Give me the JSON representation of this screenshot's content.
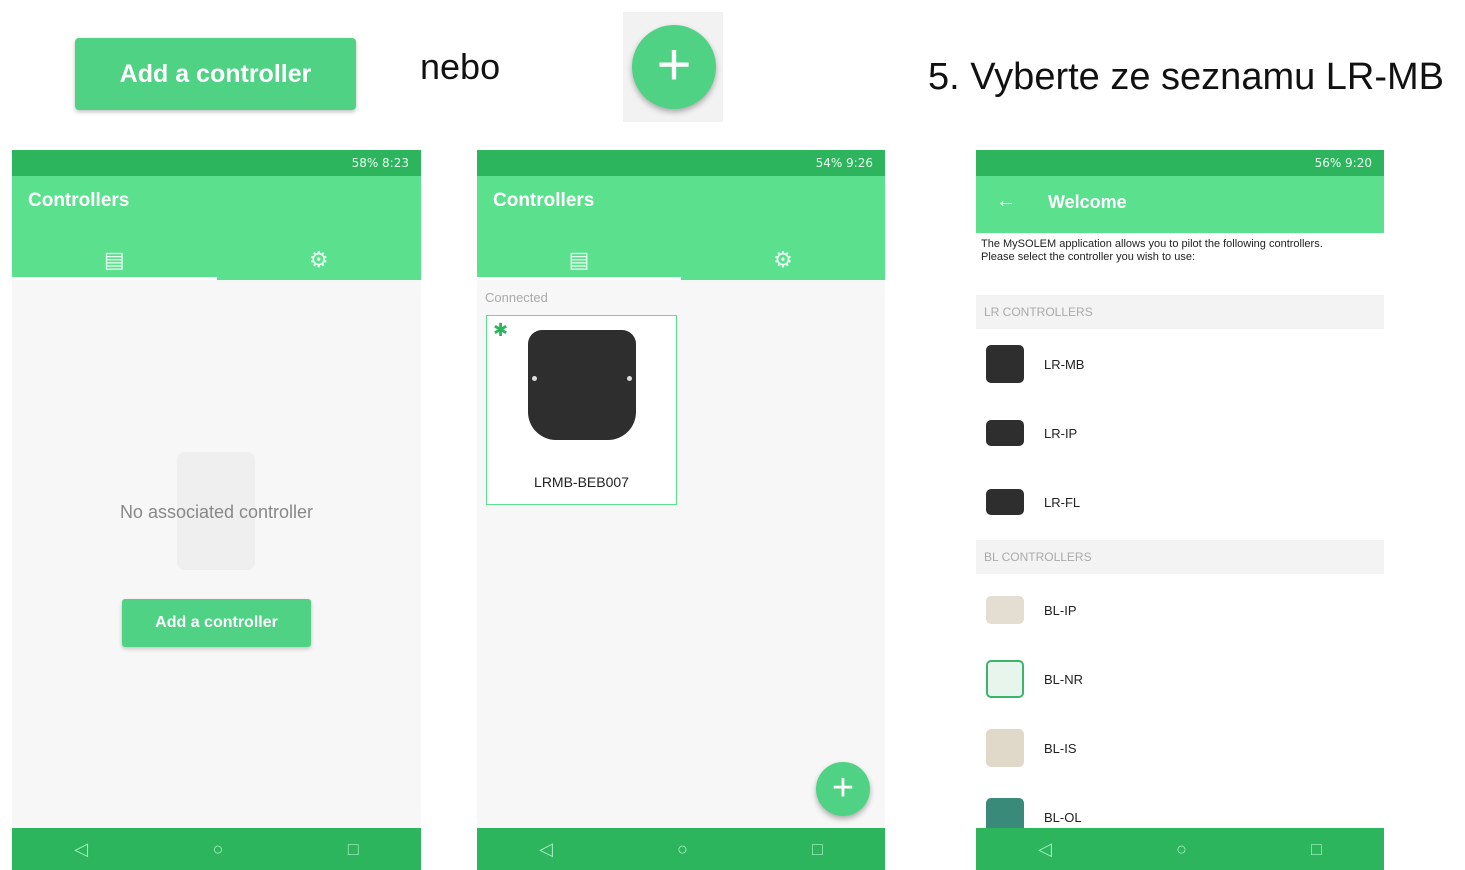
{
  "header": {
    "add_button_label": "Add a controller",
    "or_text": "nebo",
    "fab_icon": "plus-icon",
    "step_text": "5. Vyberte ze seznamu LR-MB"
  },
  "colors": {
    "accent": "#4fd283",
    "status_bar": "#2db55d",
    "app_bar": "#5be08e"
  },
  "phone1": {
    "status": "58% 8:23",
    "title": "Controllers",
    "tabs": [
      {
        "icon": "controller-icon"
      },
      {
        "icon": "gear-icon"
      }
    ],
    "empty_message": "No associated controller",
    "add_button_label": "Add a controller"
  },
  "phone2": {
    "status": "54% 9:26",
    "title": "Controllers",
    "tabs": [
      {
        "icon": "controller-icon"
      },
      {
        "icon": "gear-icon"
      }
    ],
    "section_label": "Connected",
    "device_name": "LRMB-BEB007"
  },
  "phone3": {
    "status": "56% 9:20",
    "title": "Welcome",
    "intro_line1": "The MySOLEM application allows you to pilot the following controllers.",
    "intro_line2": "Please select the controller you wish to use:",
    "groups": [
      {
        "header": "LR CONTROLLERS",
        "items": [
          "LR-MB",
          "LR-IP",
          "LR-FL"
        ]
      },
      {
        "header": "BL CONTROLLERS",
        "items": [
          "BL-IP",
          "BL-NR",
          "BL-IS",
          "BL-OL"
        ]
      }
    ]
  }
}
